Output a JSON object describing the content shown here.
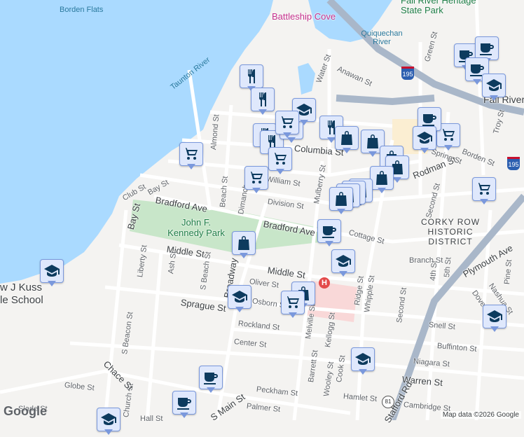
{
  "map": {
    "colors": {
      "water": "#aadaff",
      "land": "#f4f3f1",
      "park": "#c8e6c9",
      "road": "#ffffff",
      "highway": "#a9b7c9",
      "marker_bg": "#dfe8fc",
      "marker_icon": "#0d3b5e"
    },
    "labels": {
      "borden_flats": "Borden Flats",
      "battleship_cove": "Battleship Cove",
      "heritage_park": "Fall River Heritage State Park",
      "quiquechan": "Quiquechan River",
      "taunton": "Taunton River",
      "fall_river": "Fall River",
      "jfk_park": "John F. Kennedy Park",
      "corky_row": "CORKY ROW HISTORIC DISTRICT",
      "school": "Henry Lord / Matthew J Kuss Middle School",
      "school_line1": "w J Kuss",
      "school_line2": "le School",
      "streets": [
        "Water St",
        "Anawan St",
        "Green St",
        "Almond St",
        "Bay St",
        "Club St",
        "Beach St",
        "Dimanche St",
        "William St",
        "Columbia St",
        "Mulberry St",
        "Division St",
        "Bradford Ave",
        "Bradford Ave",
        "Cottage St",
        "Rodman St",
        "Spring St",
        "Borden St",
        "Second St",
        "Troy St",
        "Bay St",
        "Middle St",
        "Middle St",
        "Liberty St",
        "Ash St",
        "S Beach St",
        "Broadway",
        "Oliver St",
        "Sprague St",
        "Osborn St",
        "Rockland St",
        "Center St",
        "S Beacon St",
        "Church St",
        "Chace St",
        "Globe St",
        "S Main St",
        "Peckham St",
        "Palmer St",
        "Melville St",
        "Barrett St",
        "Kellogg St",
        "Wooley St",
        "Cook St",
        "Ridge St",
        "Whipple St",
        "Second St",
        "Branch St",
        "4th St",
        "5th St",
        "Plymouth Ave",
        "Nashua St",
        "Dover St",
        "Snell St",
        "Buffinton St",
        "Niagara St",
        "Warren St",
        "Hamlet St",
        "Cambridge St",
        "Stafford Rd",
        "Slade St",
        "Hall St",
        "Pine St"
      ],
      "highway": "195",
      "route": "81"
    },
    "markers": [
      {
        "type": "restaurant"
      },
      {
        "type": "restaurant"
      },
      {
        "type": "restaurant"
      },
      {
        "type": "restaurant"
      },
      {
        "type": "cart"
      },
      {
        "type": "cart"
      },
      {
        "type": "cart"
      },
      {
        "type": "cart"
      },
      {
        "type": "school"
      },
      {
        "type": "cart"
      },
      {
        "type": "restaurant"
      },
      {
        "type": "bag"
      },
      {
        "type": "bag"
      },
      {
        "type": "bag"
      },
      {
        "type": "bag"
      },
      {
        "type": "bag"
      },
      {
        "type": "bag"
      },
      {
        "type": "bag"
      },
      {
        "type": "bag"
      },
      {
        "type": "bag"
      },
      {
        "type": "cart"
      },
      {
        "type": "coffee"
      },
      {
        "type": "school"
      },
      {
        "type": "coffee"
      },
      {
        "type": "coffee"
      },
      {
        "type": "coffee"
      },
      {
        "type": "school"
      },
      {
        "type": "cart"
      },
      {
        "type": "coffee"
      },
      {
        "type": "bag"
      },
      {
        "type": "school"
      },
      {
        "type": "school"
      },
      {
        "type": "school"
      },
      {
        "type": "bag"
      },
      {
        "type": "cart"
      },
      {
        "type": "school"
      },
      {
        "type": "school"
      },
      {
        "type": "coffee"
      },
      {
        "type": "coffee"
      },
      {
        "type": "school"
      }
    ],
    "footer": {
      "attribution": "Map data ©2026 Google",
      "logo": "Google"
    }
  }
}
